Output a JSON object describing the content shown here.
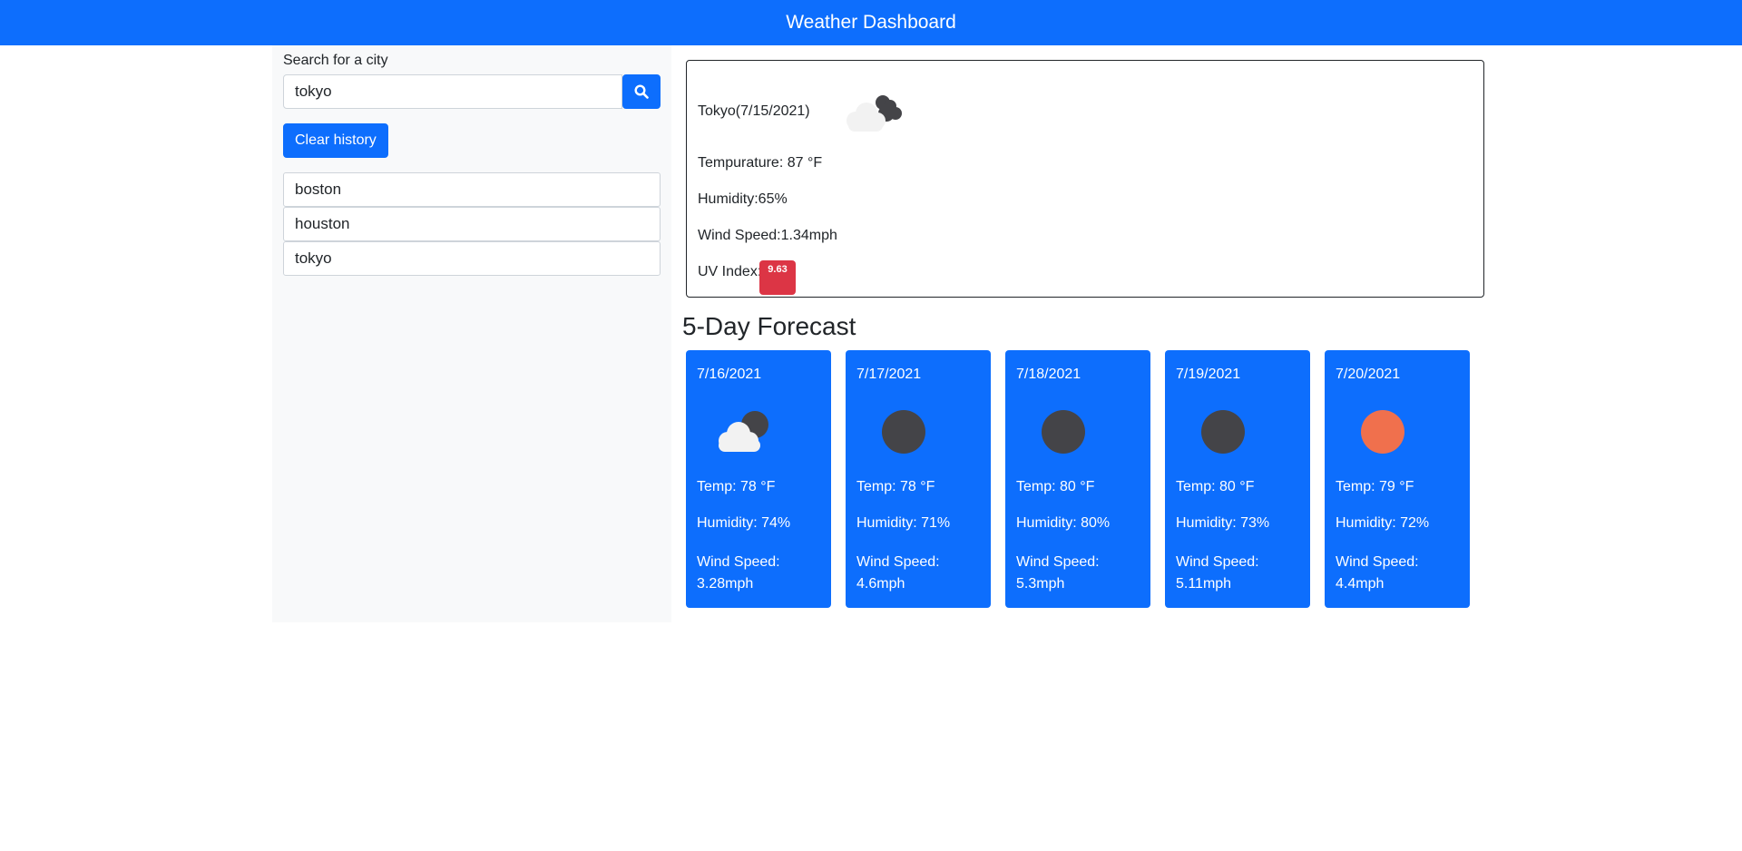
{
  "header": {
    "title": "Weather Dashboard"
  },
  "search": {
    "label": "Search for a city",
    "value": "tokyo",
    "button_icon": "search-icon",
    "clear_label": "Clear history"
  },
  "history": [
    {
      "label": "boston"
    },
    {
      "label": "houston"
    },
    {
      "label": "tokyo"
    }
  ],
  "current": {
    "city_date": "Tokyo(7/15/2021)",
    "icon": "cloud-night-icon",
    "temperature": "Tempurature: 87 °F",
    "humidity": "Humidity:65%",
    "wind": "Wind Speed:1.34mph",
    "uv_label": "UV Index:",
    "uv_value": "9.63",
    "uv_color": "#dc3545"
  },
  "forecast": {
    "title": "5-Day Forecast",
    "days": [
      {
        "date": "7/16/2021",
        "icon": "cloud-night-icon",
        "temp": "Temp: 78 °F",
        "humidity": "Humidity: 74%",
        "wind": "Wind Speed: 3.28mph"
      },
      {
        "date": "7/17/2021",
        "icon": "moon-icon",
        "temp": "Temp: 78 °F",
        "humidity": "Humidity: 71%",
        "wind": "Wind Speed: 4.6mph"
      },
      {
        "date": "7/18/2021",
        "icon": "moon-icon",
        "temp": "Temp: 80 °F",
        "humidity": "Humidity: 80%",
        "wind": "Wind Speed: 5.3mph"
      },
      {
        "date": "7/19/2021",
        "icon": "moon-icon",
        "temp": "Temp: 80 °F",
        "humidity": "Humidity: 73%",
        "wind": "Wind Speed: 5.11mph"
      },
      {
        "date": "7/20/2021",
        "icon": "sun-icon",
        "temp": "Temp: 79 °F",
        "humidity": "Humidity: 72%",
        "wind": "Wind Speed: 4.4mph"
      }
    ]
  },
  "colors": {
    "primary": "#0d6efd",
    "danger": "#dc3545",
    "sidebar_bg": "#f8f9fa",
    "moon": "#444448",
    "sun": "#f0704d",
    "cloud": "#f2f2f2"
  }
}
